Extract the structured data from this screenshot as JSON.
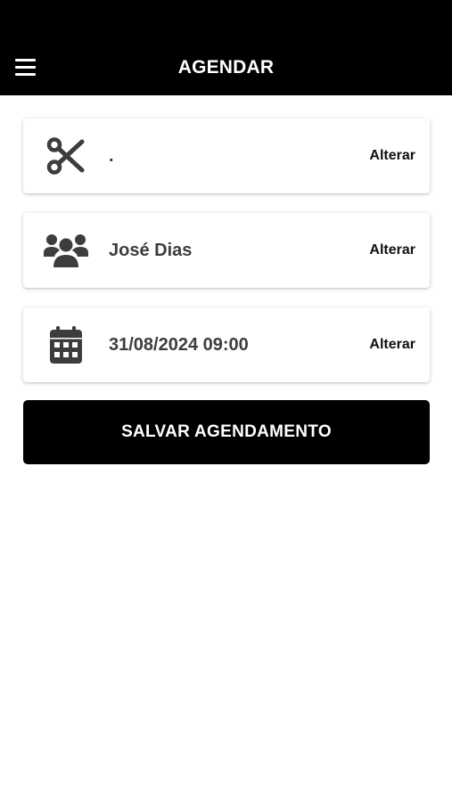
{
  "header": {
    "title": "AGENDAR",
    "menu_icon": "hamburger-menu-icon",
    "background": "#000000",
    "text_color": "#ffffff"
  },
  "cards": [
    {
      "icon": "scissors-icon",
      "value": ".",
      "action_label": "Alterar"
    },
    {
      "icon": "users-group-icon",
      "value": "José Dias",
      "action_label": "Alterar"
    },
    {
      "icon": "calendar-icon",
      "value": "31/08/2024 09:00",
      "action_label": "Alterar"
    }
  ],
  "save_button": {
    "label": "SALVAR AGENDAMENTO",
    "background": "#000000",
    "text_color": "#ffffff"
  }
}
